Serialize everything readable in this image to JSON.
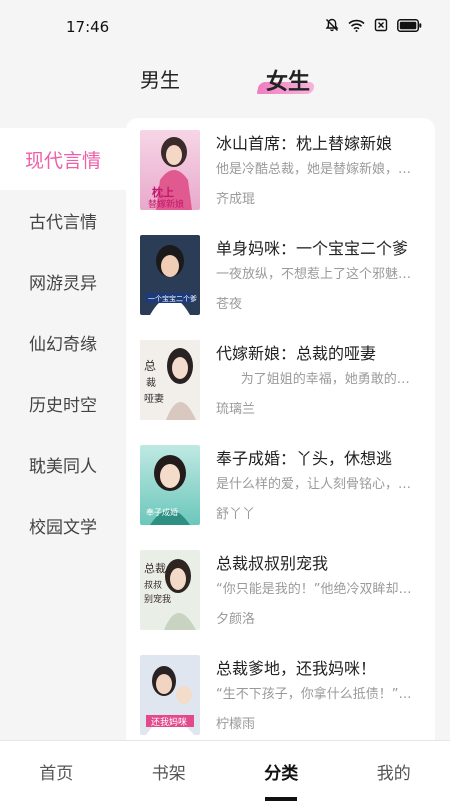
{
  "status_bar": {
    "time": "17:46"
  },
  "gender_tabs": [
    {
      "label": "男生",
      "active": false
    },
    {
      "label": "女生",
      "active": true
    }
  ],
  "categories": [
    {
      "label": "现代言情",
      "active": true
    },
    {
      "label": "古代言情",
      "active": false
    },
    {
      "label": "网游灵异",
      "active": false
    },
    {
      "label": "仙幻奇缘",
      "active": false
    },
    {
      "label": "历史时空",
      "active": false
    },
    {
      "label": "耽美同人",
      "active": false
    },
    {
      "label": "校园文学",
      "active": false
    }
  ],
  "books": [
    {
      "title": "冰山首席：枕上替嫁新娘",
      "desc": "他是冷酷总裁，她是替嫁新娘，他恨她入骨",
      "author": "齐成琨",
      "cover_text": "枕上替嫁新娘"
    },
    {
      "title": "单身妈咪：一个宝宝二个爹",
      "desc": "一夜放纵，不想惹上了这个邪魅的男人",
      "author": "苍夜",
      "cover_text": "一个宝宝二个爹"
    },
    {
      "title": "代嫁新娘：总裁的哑妻",
      "desc": "      为了姐姐的幸福，她勇敢的嫁入豪门",
      "author": "琉璃兰",
      "cover_text": "总裁的哑妻"
    },
    {
      "title": "奉子成婚：丫头，休想逃",
      "desc": "是什么样的爱，让人刻骨铭心，难以忘怀",
      "author": "舒丫丫",
      "cover_text": "奉子成婚"
    },
    {
      "title": "总裁叔叔别宠我",
      "desc": "“你只能是我的！”他绝冷双眸却温柔似水",
      "author": "夕颜洛",
      "cover_text": "总裁叔叔别宠我"
    },
    {
      "title": "总裁爹地，还我妈咪！",
      "desc": "“生不下孩子，你拿什么抵债！”他冷冷地说",
      "author": "柠檬雨",
      "cover_text": "还我妈咪"
    }
  ],
  "bottom_nav": [
    {
      "label": "首页",
      "active": false
    },
    {
      "label": "书架",
      "active": false
    },
    {
      "label": "分类",
      "active": true
    },
    {
      "label": "我的",
      "active": false
    }
  ],
  "colors": {
    "accent": "#ee5fa8",
    "background": "#f5f5f5",
    "panel": "#ffffff"
  }
}
